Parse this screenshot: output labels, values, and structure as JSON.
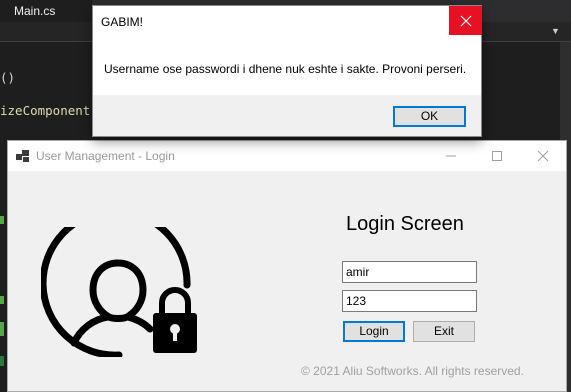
{
  "ide": {
    "file_tab": "Main.cs",
    "code_lines": [
      "()",
      "izeComponent()"
    ]
  },
  "login_window": {
    "title": "User Management - Login",
    "heading": "Login Screen",
    "username": {
      "value": "amir"
    },
    "password": {
      "value": "123"
    },
    "login_label": "Login",
    "exit_label": "Exit",
    "copyright": "© 2021 Aliu Softworks. All rights reserved."
  },
  "message_box": {
    "title": "GABIM!",
    "message": "Username ose passwordi i dhene nuk eshte i sakte. Provoni perseri.",
    "ok_label": "OK"
  },
  "colors": {
    "accent": "#0078d7",
    "close_red": "#e81123",
    "ide_background": "#1e1e1e"
  },
  "icons": [
    "app-icon",
    "minimize-icon",
    "maximize-icon",
    "close-icon",
    "user-avatar-icon",
    "padlock-icon",
    "combo-arrow-icon"
  ]
}
